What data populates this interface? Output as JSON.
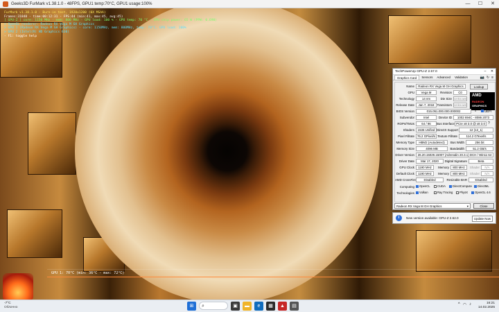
{
  "furmark": {
    "title": "Geeks3D FurMark v1.38.1.0 - 48FPS, GPU1 temp:70°C, GPU1 usage:100%",
    "win_min": "—",
    "win_max": "☐",
    "win_close": "✕",
    "overlay": {
      "line1": "FurMark v1.38.1.0 - Burn-in test, 1920x1200 (0X MSAA)",
      "line2": "Frames:31848 - time:00:12:31 - FPS:44 (min:41, max:45, avg:45)",
      "line3": "[ GPU-Z ] core: 1150 MHz - mem: 800 MHz - GPU load: 100 % - GPU temp: 70 °C - GPU chip power: 65 W (PPW: 0.690)",
      "line4": "> OpenGL renderer: Radeon RX Vega M GH Graphics",
      "line5": "> GPU 1 (Radeon RX Vega M GH Graphics) - core: 1150MHz, mem: 800MHz, temp: 70°C, GPU load: 100%",
      "line6": "> GPU 2 (Intel(R) HD Graphics 630)",
      "line7": "- F1: toggle help"
    },
    "graph_label": "GPU 1: 70°C (min: 36°C - max: 72°C)"
  },
  "gpuz": {
    "title": "TechPowerUp GPU-Z 2.57.0",
    "tabs": [
      "Graphics Card",
      "Sensors",
      "Advanced",
      "Validation"
    ],
    "tools": {
      "camera": "📷",
      "refresh": "↻",
      "menu": "≡"
    },
    "labels": {
      "name": "Name",
      "gpu": "GPU",
      "revision": "Revision",
      "technology": "Technology",
      "die_size": "Die Size",
      "release_date": "Release Date",
      "transistors": "Transistors",
      "bios": "BIOS Version",
      "subvendor": "Subvendor",
      "device_id": "Device ID",
      "rops": "ROPs/TMUs",
      "bus_interface": "Bus Interface",
      "shaders": "Shaders",
      "directx": "DirectX Support",
      "pixel_fillrate": "Pixel Fillrate",
      "texture_fillrate": "Texture Fillrate",
      "memory_type": "Memory Type",
      "bus_width": "Bus Width",
      "memory_size": "Memory Size",
      "bandwidth": "Bandwidth",
      "driver_version": "Driver Version",
      "driver_date": "Driver Date",
      "digital_signature": "Digital Signature",
      "gpu_clock": "GPU Clock",
      "memory": "Memory",
      "shader": "Shader",
      "default_clock": "Default Clock",
      "crossfire": "AMD CrossFire",
      "resizable_bar": "Resizable BAR",
      "computing": "Computing",
      "technologies": "Technologies"
    },
    "values": {
      "name": "Radeon RX Vega M GH Graphics",
      "lookup": "Lookup",
      "gpu": "Vega M",
      "revision": "C0",
      "technology": "14 nm",
      "die_size": "Unknown",
      "release_date": "Jan 7, 2018",
      "transistors": "Unknown",
      "bios": "015.051.000.000.000002",
      "uefi": "UEFI",
      "subvendor": "Intel",
      "device_id": "1002 694C - 8086 2073",
      "rops": "64 / 96",
      "bus_interface": "PCIe x8 3.0 @ x8 3.0",
      "shaders": "1536 Unified",
      "directx": "12 (12_1)",
      "pixel_fillrate": "76.2 GPixel/s",
      "texture_fillrate": "114.2 GTexel/s",
      "memory_type": "HBM2 (Autodetect)",
      "bus_width": "256 bit",
      "memory_size": "4096 MB",
      "bandwidth": "51.2 GB/s",
      "driver_version": "26.20.15029.15007 (Adrenalin 20.3.1) DCH / Win11 64",
      "driver_date": "Mar 17, 2020",
      "digital_signature": "Beta",
      "gpu_clock": "1190 MHz",
      "gpu_mem": "800 MHz",
      "gpu_shader": "N/A",
      "default_clock": "1190 MHz",
      "default_mem": "800 MHz",
      "default_shader": "N/A",
      "crossfire": "Disabled",
      "resizable_bar": "Disabled"
    },
    "computing": [
      {
        "label": "OpenCL",
        "checked": true
      },
      {
        "label": "CUDA",
        "checked": false
      },
      {
        "label": "DirectCompute",
        "checked": true
      },
      {
        "label": "DirectML",
        "checked": true
      }
    ],
    "technologies": [
      {
        "label": "Vulkan",
        "checked": true
      },
      {
        "label": "Ray Tracing",
        "checked": false
      },
      {
        "label": "PhysX",
        "checked": false
      },
      {
        "label": "OpenGL 4.6",
        "checked": true
      }
    ],
    "amd_logo": {
      "brand": "AMD",
      "line1": "RADEON",
      "line2": "GRAPHICS"
    },
    "selected_gpu": "Radeon RX Vega M GH Graphics",
    "close": "Close",
    "notify": {
      "message": "New version available: GPU-Z 2.62.0",
      "button": "Update Now",
      "icon": "i"
    }
  },
  "taskbar": {
    "weather_temp": "-7°C",
    "weather_desc": "Облачно",
    "search": "",
    "time": "16:21",
    "date": "14.02.2025",
    "tray": {
      "arrow": "^",
      "wifi": "◠",
      "sound": "♪"
    }
  }
}
